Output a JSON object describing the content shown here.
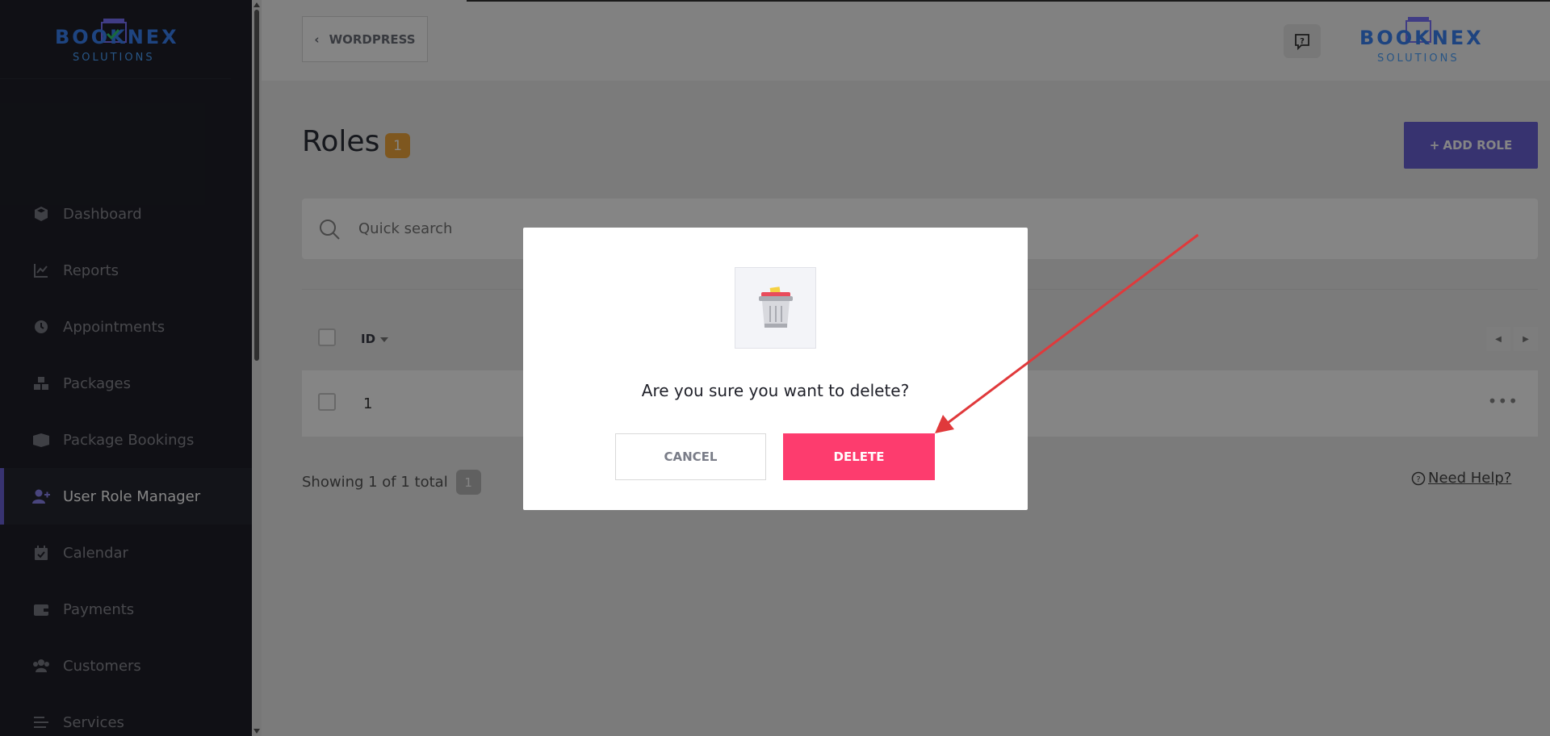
{
  "brand": {
    "name": "BOOKNEX",
    "subtitle": "SOLUTIONS"
  },
  "sidebar": {
    "items": [
      {
        "label": "Dashboard",
        "icon": "cube-icon"
      },
      {
        "label": "Reports",
        "icon": "chart-line-icon"
      },
      {
        "label": "Appointments",
        "icon": "clock-icon"
      },
      {
        "label": "Packages",
        "icon": "boxes-icon"
      },
      {
        "label": "Package Bookings",
        "icon": "box-open-icon"
      },
      {
        "label": "User Role Manager",
        "icon": "user-plus-icon",
        "active": true
      },
      {
        "label": "Calendar",
        "icon": "calendar-check-icon"
      },
      {
        "label": "Payments",
        "icon": "wallet-icon"
      },
      {
        "label": "Customers",
        "icon": "users-icon"
      },
      {
        "label": "Services",
        "icon": "list-icon"
      }
    ]
  },
  "topbar": {
    "back_label": "WORDPRESS"
  },
  "page": {
    "title": "Roles",
    "count": "1",
    "add_button": "ADD ROLE",
    "search_placeholder": "Quick search",
    "table": {
      "header_id": "ID",
      "rows": [
        {
          "id": "1"
        }
      ]
    },
    "showing_text": "Showing 1 of 1 total",
    "showing_count": "1",
    "need_help": "Need Help?"
  },
  "modal": {
    "message": "Are you sure you want to delete?",
    "cancel_label": "CANCEL",
    "delete_label": "DELETE"
  },
  "colors": {
    "sidebar_bg": "#1f2029",
    "accent": "#6a62d6",
    "badge": "#f2a73c",
    "delete": "#fd3c6e",
    "annotation_arrow": "#e0393b"
  }
}
